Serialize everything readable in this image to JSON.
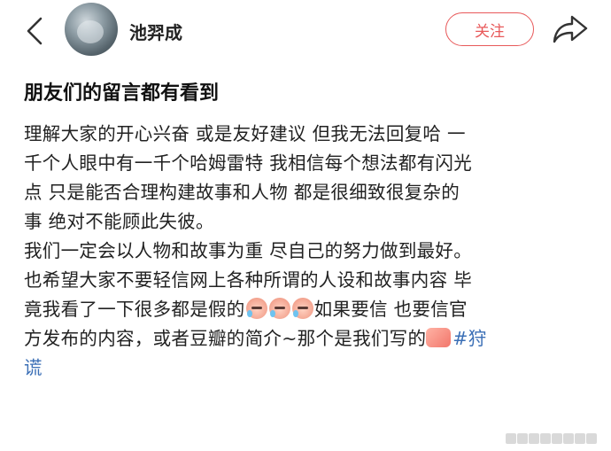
{
  "header": {
    "username": "池羿成",
    "follow_label": "关注"
  },
  "post": {
    "title": "朋友们的留言都有看到",
    "lines": [
      "理解大家的开心兴奋  或是友好建议  但我无法回复哈 一",
      "千个人眼中有一千个哈姆雷特  我相信每个想法都有闪光",
      "点  只是能否合理构建故事和人物   都是很细致很复杂的",
      "事  绝对不能顾此失彼。",
      "我们一定会以人物和故事为重  尽自己的努力做到最好。",
      "也希望大家不要轻信网上各种所谓的人设和故事内容  毕",
      "竟我看了一下很多都是假的",
      "如果要信  也要信官",
      "方发布的内容，或者豆瓣的简介~那个是我们写的",
      "#狩",
      "谎"
    ]
  },
  "icons": {
    "back": "chevron-left-icon",
    "share": "share-arrow-icon",
    "emoji": "crying-laugh-emoji-icon",
    "thumb": "thumbs-up-emoji-icon"
  },
  "colors": {
    "accent": "#e8595a",
    "link": "#3b6fb6"
  }
}
